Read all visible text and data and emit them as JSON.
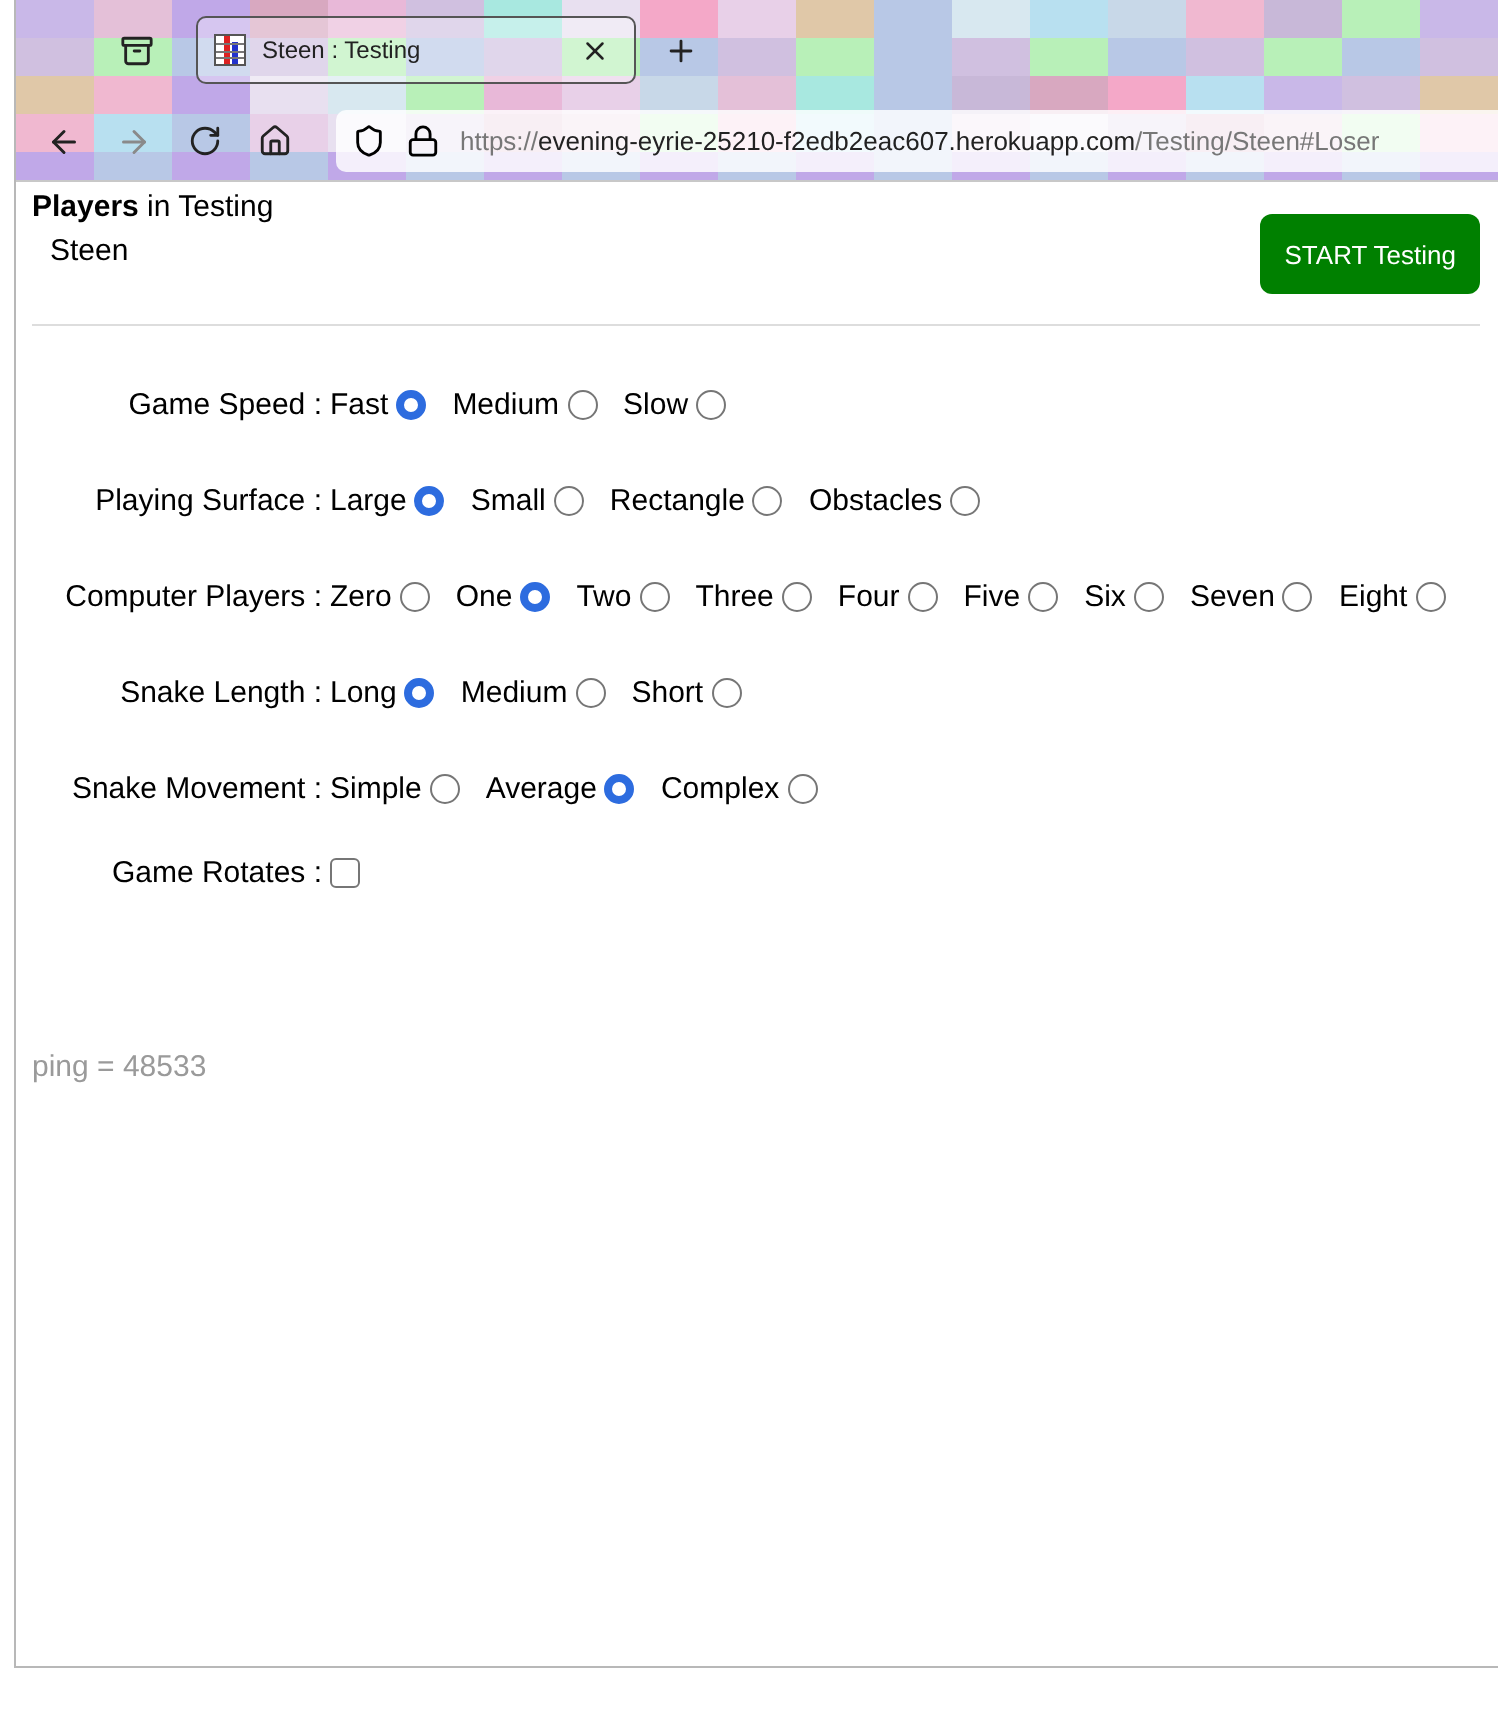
{
  "browser": {
    "tab": {
      "title": "Steen : Testing",
      "selected": true
    },
    "url": {
      "scheme": "https://",
      "host": "evening-eyrie-25210-f2edb2eac607.herokuapp.com",
      "path": "/Testing/Steen#Loser"
    }
  },
  "header": {
    "title": "**Players** in Testing",
    "player": "Steen",
    "start_button": "START Testing"
  },
  "settings": [
    {
      "kind": "radio",
      "label": "Game Speed :",
      "options": [
        {
          "label": "Fast",
          "selected": true
        },
        {
          "label": "Medium",
          "selected": false
        },
        {
          "label": "Slow",
          "selected": false
        }
      ]
    },
    {
      "kind": "radio",
      "label": "Playing Surface :",
      "options": [
        {
          "label": "Large",
          "selected": true
        },
        {
          "label": "Small",
          "selected": false
        },
        {
          "label": "Rectangle",
          "selected": false
        },
        {
          "label": "Obstacles",
          "selected": false
        }
      ]
    },
    {
      "kind": "radio",
      "label": "Computer Players :",
      "options": [
        {
          "label": "Zero",
          "selected": false
        },
        {
          "label": "One",
          "selected": true
        },
        {
          "label": "Two",
          "selected": false
        },
        {
          "label": "Three",
          "selected": false
        },
        {
          "label": "Four",
          "selected": false
        },
        {
          "label": "Five",
          "selected": false
        },
        {
          "label": "Six",
          "selected": false
        },
        {
          "label": "Seven",
          "selected": false
        },
        {
          "label": "Eight",
          "selected": false
        }
      ]
    },
    {
      "kind": "radio",
      "label": "Snake Length :",
      "options": [
        {
          "label": "Long",
          "selected": true
        },
        {
          "label": "Medium",
          "selected": false
        },
        {
          "label": "Short",
          "selected": false
        }
      ]
    },
    {
      "kind": "radio",
      "label": "Snake Movement :",
      "options": [
        {
          "label": "Simple",
          "selected": false
        },
        {
          "label": "Average",
          "selected": true
        },
        {
          "label": "Complex",
          "selected": false
        }
      ]
    },
    {
      "kind": "checkbox",
      "label": "Game Rotates :",
      "checked": false
    }
  ],
  "ping": "ping = 48533"
}
